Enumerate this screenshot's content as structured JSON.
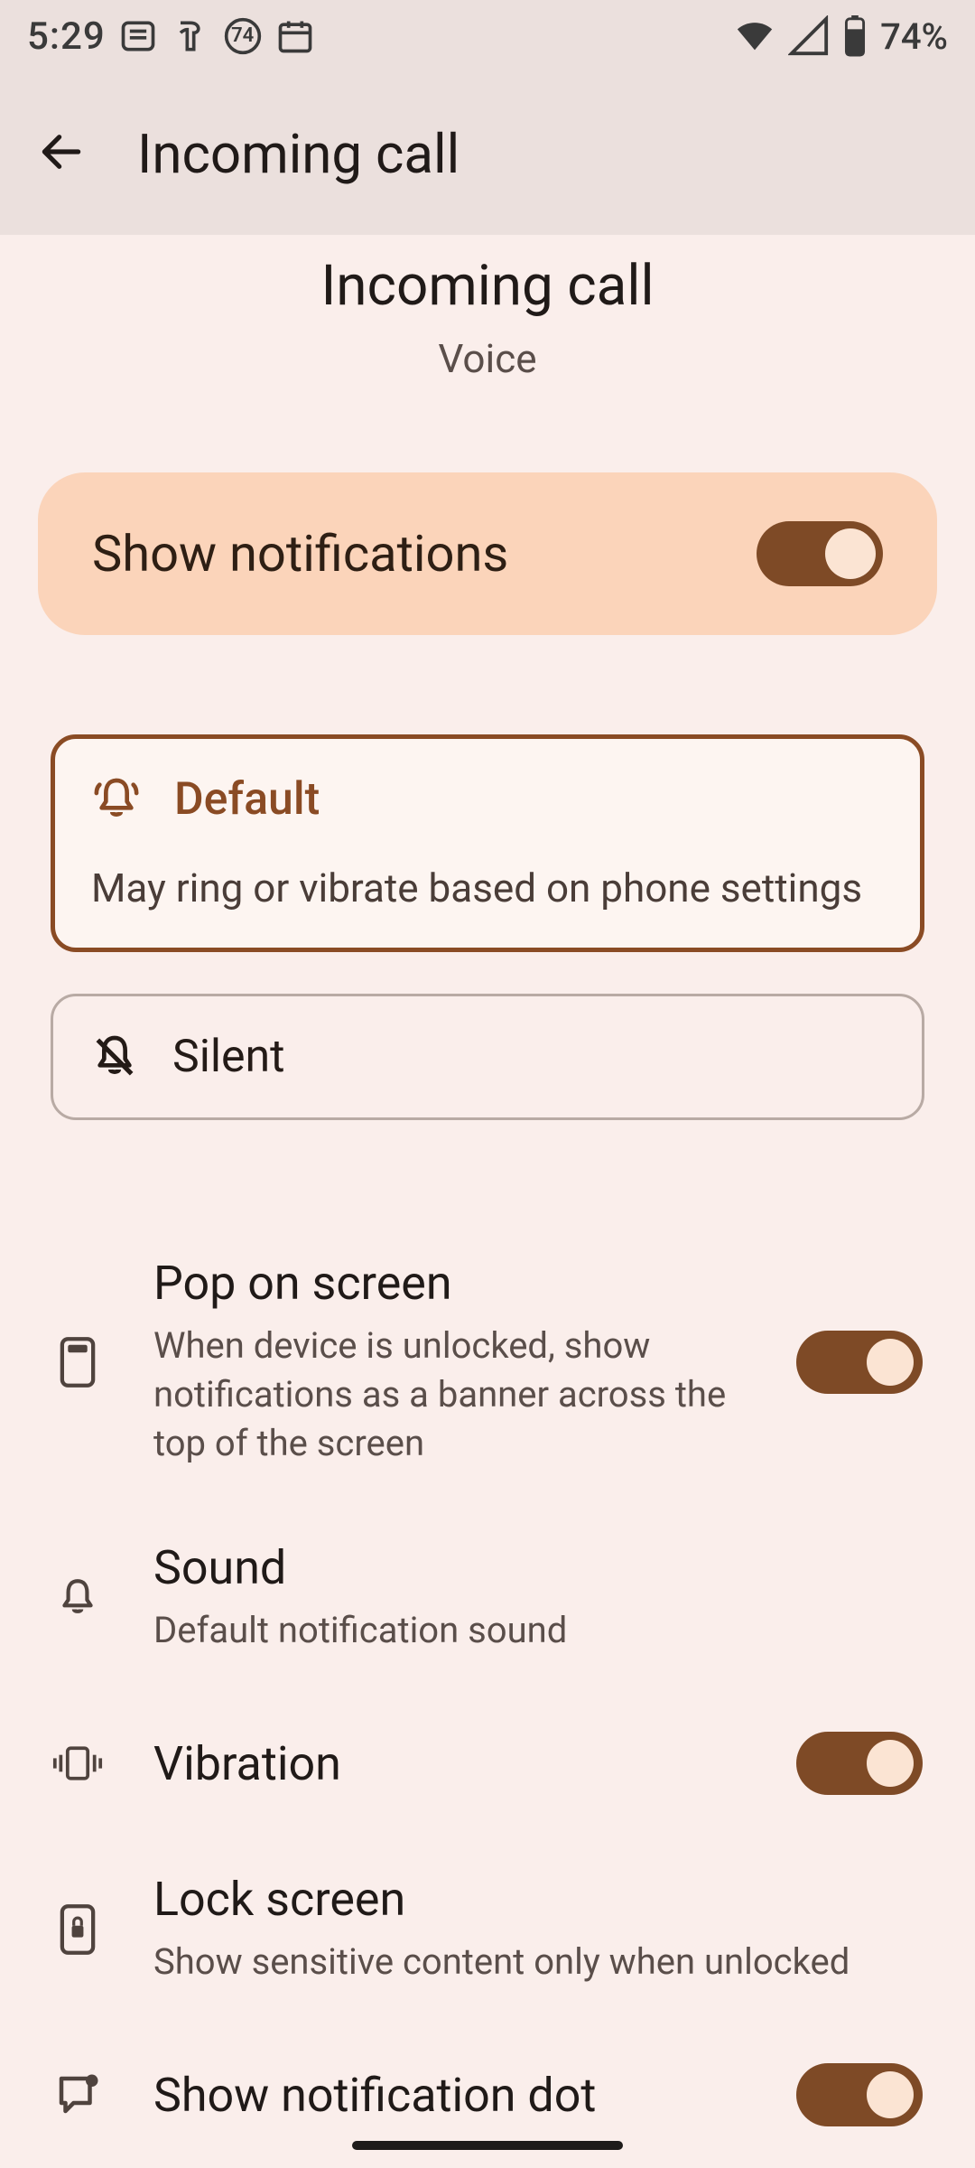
{
  "status_bar": {
    "time": "5:29",
    "badge_value": "74",
    "battery_percent": "74%"
  },
  "header": {
    "title": "Incoming call"
  },
  "page": {
    "title": "Incoming call",
    "subtitle": "Voice"
  },
  "master_toggle": {
    "label": "Show notifications",
    "enabled": true
  },
  "modes": {
    "default": {
      "title": "Default",
      "desc": "May ring or vibrate based on phone settings",
      "selected": true
    },
    "silent": {
      "title": "Silent",
      "selected": false
    }
  },
  "settings": {
    "pop_on_screen": {
      "title": "Pop on screen",
      "desc": "When device is unlocked, show notifications as a banner across the top of the screen",
      "enabled": true
    },
    "sound": {
      "title": "Sound",
      "desc": "Default notification sound"
    },
    "vibration": {
      "title": "Vibration",
      "enabled": true
    },
    "lock_screen": {
      "title": "Lock screen",
      "desc": "Show sensitive content only when unlocked"
    },
    "notification_dot": {
      "title": "Show notification dot",
      "enabled": true
    }
  },
  "colors": {
    "accent": "#7e4a26",
    "card_peach": "#fbd4ba",
    "bg": "#faeeeb",
    "header_bg": "#ebe0dd"
  }
}
